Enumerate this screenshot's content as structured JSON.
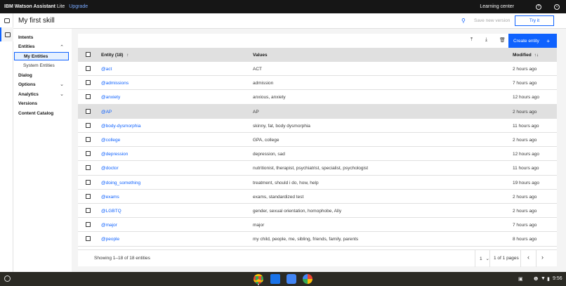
{
  "topbar": {
    "brand_bold": "IBM Watson Assistant",
    "brand_tier": "Lite",
    "upgrade": "Upgrade",
    "learning_center": "Learning center",
    "help_icon": "help-icon",
    "user_icon": "user-icon"
  },
  "header": {
    "title": "My first skill",
    "save_version": "Save new version",
    "try_it": "Try it"
  },
  "nav": {
    "intents": "Intents",
    "entities": "Entities",
    "my_entities": "My Entities",
    "system_entities": "System Entities",
    "dialog": "Dialog",
    "options": "Options",
    "analytics": "Analytics",
    "versions": "Versions",
    "content_catalog": "Content Catalog"
  },
  "toolbar": {
    "create_entity": "Create entity",
    "create_plus": "+"
  },
  "table": {
    "col_entity": "Entity (18)",
    "col_entity_sort": "↑",
    "col_values": "Values",
    "col_modified": "Modified",
    "col_modified_sort": "↑↓",
    "rows": [
      {
        "entity": "@act",
        "values": "ACT",
        "modified": "2 hours ago"
      },
      {
        "entity": "@admissions",
        "values": "admission",
        "modified": "7 hours ago"
      },
      {
        "entity": "@anxiety",
        "values": "anxious, anxiety",
        "modified": "12 hours ago"
      },
      {
        "entity": "@AP",
        "values": "AP",
        "modified": "2 hours ago"
      },
      {
        "entity": "@body-dysmorphia",
        "values": "skinny, fat, body dysmorphia",
        "modified": "11 hours ago"
      },
      {
        "entity": "@college",
        "values": "GPA, college",
        "modified": "2 hours ago"
      },
      {
        "entity": "@depression",
        "values": "depression, sad",
        "modified": "12 hours ago"
      },
      {
        "entity": "@doctor",
        "values": "nutritionist, therapist, psychiatrist, specialist, psychologist",
        "modified": "11 hours ago"
      },
      {
        "entity": "@doing_something",
        "values": "treatment, should i do, how, help",
        "modified": "19 hours ago"
      },
      {
        "entity": "@exams",
        "values": "exams, standardized test",
        "modified": "2 hours ago"
      },
      {
        "entity": "@LGBTQ",
        "values": "gender, sexual orientation, homophobe, Ally",
        "modified": "2 hours ago"
      },
      {
        "entity": "@major",
        "values": "major",
        "modified": "7 hours ago"
      },
      {
        "entity": "@people",
        "values": "my child, people, me, sibling, friends, family, parents",
        "modified": "8 hours ago"
      }
    ]
  },
  "footer": {
    "showing": "Showing 1–18 of 18 entities",
    "page": "1",
    "page_chevron": "⌄",
    "of_pages": "1 of 1 pages",
    "prev": "‹",
    "next": "›"
  },
  "taskbar": {
    "time": "9:56",
    "apps": [
      "chrome-icon",
      "files-icon",
      "camera-icon",
      "photos-icon"
    ]
  },
  "colors": {
    "accent": "#0f62fe",
    "topbar_bg": "#161616",
    "link": "#0f62fe",
    "upgrade": "#78a9ff"
  }
}
